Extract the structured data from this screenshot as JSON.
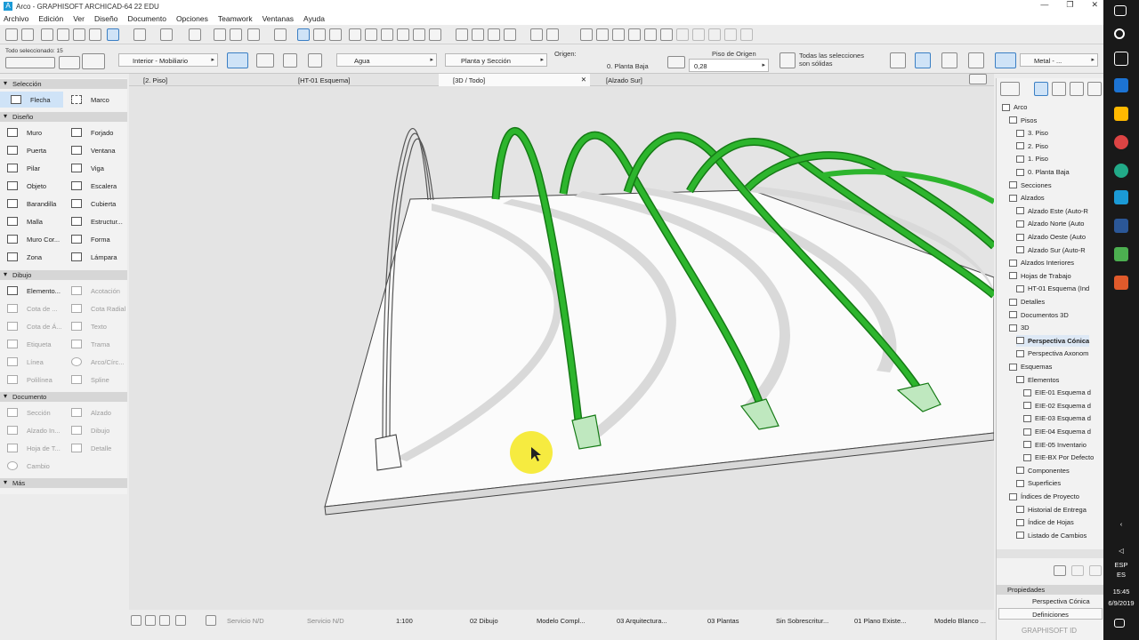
{
  "window": {
    "title": "Arco - GRAPHISOFT ARCHICAD-64 22 EDU",
    "controls": [
      "—",
      "❐",
      "✕"
    ]
  },
  "menu": [
    "Archivo",
    "Edición",
    "Ver",
    "Diseño",
    "Documento",
    "Opciones",
    "Teamwork",
    "Ventanas",
    "Ayuda"
  ],
  "infobox": {
    "selected": "Todo seleccionado: 15",
    "layer_combo": "Interior - Mobiliario",
    "material": "Agua",
    "view_mode": "Planta y Sección",
    "origin_label": "Origen:",
    "origin_value": "0. Planta Baja",
    "origin_story_label": "Piso de Origen",
    "offset_value": "0,28",
    "solid_note_1": "Todas las selecciones",
    "solid_note_2": "son sólidas",
    "surface": "Metal - ..."
  },
  "tabs": [
    {
      "label": "[2. Piso]",
      "active": false
    },
    {
      "label": "[HT-01 Esquema]",
      "active": false
    },
    {
      "label": "[3D / Todo]",
      "active": true
    },
    {
      "label": "[Alzado Sur]",
      "active": false
    }
  ],
  "toolbox": {
    "sections": {
      "seleccion": "Selección",
      "diseno": "Diseño",
      "dibujo": "Dibujo",
      "documento": "Documento",
      "mas": "Más"
    },
    "seleccion": [
      "Flecha",
      "Marco"
    ],
    "diseno": [
      "Muro",
      "Forjado",
      "Puerta",
      "Ventana",
      "Pilar",
      "Viga",
      "Objeto",
      "Escalera",
      "Barandilla",
      "Cubierta",
      "Malla",
      "Estructur...",
      "Muro Cor...",
      "Forma",
      "Zona",
      "Lámpara"
    ],
    "dibujo": [
      "Elemento...",
      "Acotación",
      "Cota de ...",
      "Cota Radial",
      "Cota de Á...",
      "Texto",
      "Etiqueta",
      "Trama",
      "Línea",
      "Arco/Círc...",
      "Polilínea",
      "Spline"
    ],
    "documento": [
      "Sección",
      "Alzado",
      "Alzado In...",
      "Dibujo",
      "Hoja de T...",
      "Detalle",
      "Cambio"
    ]
  },
  "navigator": {
    "tree": [
      {
        "label": "Arco",
        "level": 0
      },
      {
        "label": "Pisos",
        "level": 1
      },
      {
        "label": "3. Piso",
        "level": 2
      },
      {
        "label": "2. Piso",
        "level": 2
      },
      {
        "label": "1. Piso",
        "level": 2
      },
      {
        "label": "0. Planta Baja",
        "level": 2
      },
      {
        "label": "Secciones",
        "level": 1
      },
      {
        "label": "Alzados",
        "level": 1
      },
      {
        "label": "Alzado Este (Auto-R",
        "level": 2
      },
      {
        "label": "Alzado Norte (Auto",
        "level": 2
      },
      {
        "label": "Alzado Oeste (Auto",
        "level": 2
      },
      {
        "label": "Alzado Sur (Auto-R",
        "level": 2
      },
      {
        "label": "Alzados Interiores",
        "level": 1
      },
      {
        "label": "Hojas de Trabajo",
        "level": 1
      },
      {
        "label": "HT-01 Esquema (Ind",
        "level": 2
      },
      {
        "label": "Detalles",
        "level": 1
      },
      {
        "label": "Documentos 3D",
        "level": 1
      },
      {
        "label": "3D",
        "level": 1
      },
      {
        "label": "Perspectiva Cónica",
        "level": 2,
        "selected": true
      },
      {
        "label": "Perspectiva Axonom",
        "level": 2
      },
      {
        "label": "Esquemas",
        "level": 1
      },
      {
        "label": "Elementos",
        "level": 2
      },
      {
        "label": "EIE-01 Esquema d",
        "level": 3
      },
      {
        "label": "EIE-02 Esquema d",
        "level": 3
      },
      {
        "label": "EIE-03 Esquema d",
        "level": 3
      },
      {
        "label": "EIE-04 Esquema d",
        "level": 3
      },
      {
        "label": "EIE-05 Inventario",
        "level": 3
      },
      {
        "label": "EIE-BX Por Defecto",
        "level": 3
      },
      {
        "label": "Componentes",
        "level": 2
      },
      {
        "label": "Superficies",
        "level": 2
      },
      {
        "label": "Índices de Proyecto",
        "level": 1
      },
      {
        "label": "Historial de Entrega",
        "level": 2
      },
      {
        "label": "Índice de Hojas",
        "level": 2
      },
      {
        "label": "Listado de Cambios",
        "level": 2
      }
    ],
    "properties_title": "Propiedades",
    "properties_value": "Perspectiva Cónica",
    "definitions_button": "Definiciones",
    "brand": "GRAPHISOFT ID"
  },
  "statusbar": {
    "service1": "Servicio N/D",
    "service2": "Servicio N/D",
    "scale": "1:100",
    "drawing": "02 Dibujo",
    "model": "Modelo Compl...",
    "arch": "03 Arquitectura...",
    "plans": "03 Plantas",
    "override": "Sin Sobrescritur...",
    "existing": "01 Plano Existe...",
    "white_model": "Modelo Blanco ..."
  },
  "taskbar": {
    "lang1": "ESP",
    "lang2": "ES",
    "time": "15:45",
    "date": "6/9/2019"
  },
  "colors": {
    "arch_green": "#2db52d",
    "arch_outline": "#157a15",
    "cursor_highlight": "#f5e81e"
  }
}
